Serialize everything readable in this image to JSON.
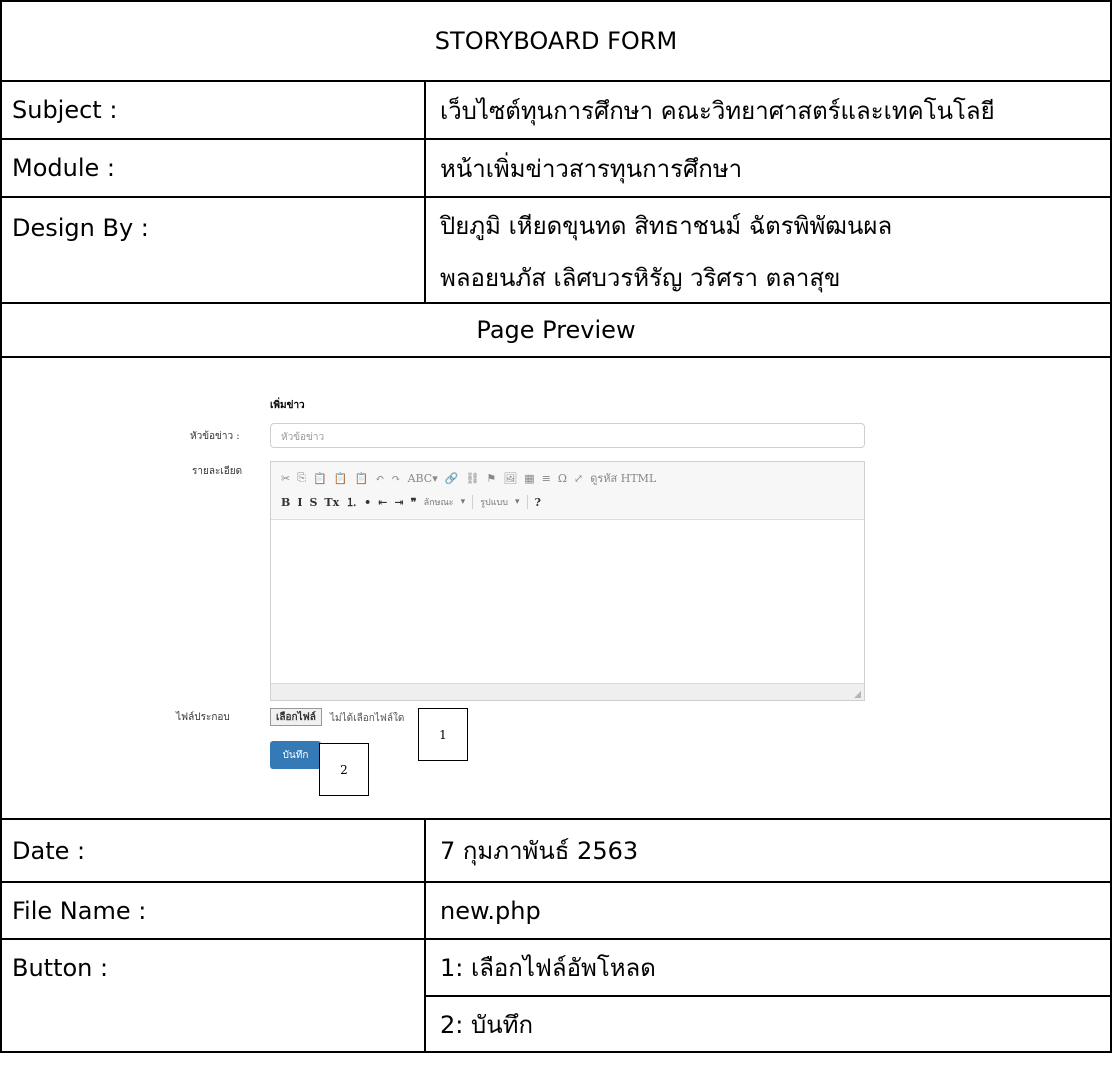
{
  "form_title": "STORYBOARD FORM",
  "fields": {
    "subject_label": "Subject :",
    "subject_value": "เว็บไซต์ทุนการศึกษา คณะวิทยาศาสตร์และเทคโนโลยี",
    "module_label": "Module :",
    "module_value": "หน้าเพิ่มข่าวสารทุนการศึกษา",
    "design_label": "Design By :",
    "design_line1": "ปิยภูมิ เหียดขุนทด  สิทธาชนม์ ฉัตรพิพัฒนผล",
    "design_line2": "พลอยนภัส เลิศบวรหิรัญ  วริศรา ตลาสุข",
    "preview_label": "Page Preview",
    "date_label": "Date :",
    "date_value": "7 กุมภาพันธ์ 2563",
    "filename_label": "File Name :",
    "filename_value": "new.php",
    "button_label": "Button :",
    "button_1": "1: เลือกไฟล์อัพโหลด",
    "button_2": "2: บันทึก"
  },
  "preview": {
    "heading": "เพิ่มข่าว",
    "title_label": "หัวข้อข่าว :",
    "title_placeholder": "หัวข้อข่าว",
    "detail_label": "รายละเอียด",
    "toolbar_row1": [
      "✂",
      "⎘",
      "📋",
      "📋",
      "📋",
      "↶",
      "↷",
      "ABC▾",
      "🔗",
      "⛓",
      "⚑",
      "🖼",
      "▦",
      "≡",
      "Ω",
      "⤢",
      "ดูรหัส HTML"
    ],
    "toolbar_row2": [
      "B",
      "I",
      "S",
      "Tx",
      "⒈",
      "•",
      "⇤",
      "⇥",
      "❞"
    ],
    "style_select": "ลักษณะ",
    "format_select": "รูปแบบ",
    "help": "?",
    "attach_label": "ไฟล์ประกอบ",
    "choose_file": "เลือกไฟล์",
    "no_file": "ไม่ได้เลือกไฟล์ใด",
    "save": "บันทึก",
    "callout_1": "1",
    "callout_2": "2"
  }
}
